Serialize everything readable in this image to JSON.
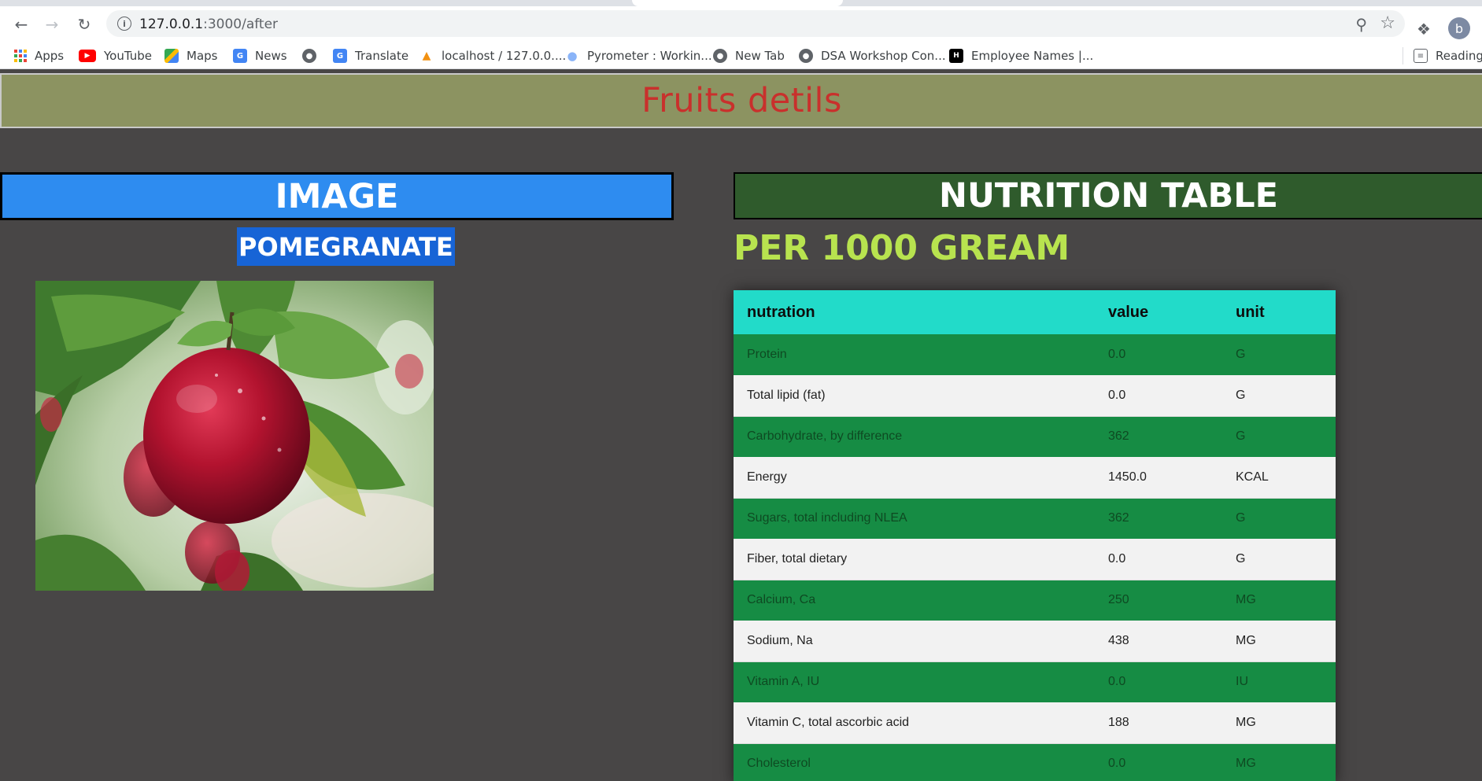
{
  "browser": {
    "url_host": "127.0.0.1",
    "url_path": ":3000/after",
    "profile_initial": "b",
    "bookmarks": [
      {
        "label": "Apps",
        "icon": "apps-grid-icon"
      },
      {
        "label": "YouTube",
        "icon": "youtube-icon"
      },
      {
        "label": "Maps",
        "icon": "maps-icon"
      },
      {
        "label": "News",
        "icon": "news-icon"
      },
      {
        "label": "",
        "icon": "globe-icon"
      },
      {
        "label": "Translate",
        "icon": "translate-icon"
      },
      {
        "label": "localhost / 127.0.0....",
        "icon": "phpmyadmin-icon"
      },
      {
        "label": "Pyrometer : Workin...",
        "icon": "bulb-icon"
      },
      {
        "label": "New Tab",
        "icon": "globe-icon"
      },
      {
        "label": "DSA Workshop Con...",
        "icon": "globe-icon"
      },
      {
        "label": "Employee Names |...",
        "icon": "hackerrank-icon"
      },
      {
        "label": "Reading",
        "icon": "reading-list-icon"
      }
    ]
  },
  "page": {
    "title": "Fruits detils",
    "image_header": "IMAGE",
    "fruit_name": "POMEGRANATE",
    "nutrition_header": "NUTRITION TABLE",
    "per_label": "PER 1000 GREAM"
  },
  "table": {
    "headers": [
      "nutration",
      "value",
      "unit"
    ],
    "rows": [
      [
        "Protein",
        "0.0",
        "G"
      ],
      [
        "Total lipid (fat)",
        "0.0",
        "G"
      ],
      [
        "Carbohydrate, by difference",
        "362",
        "G"
      ],
      [
        "Energy",
        "1450.0",
        "KCAL"
      ],
      [
        "Sugars, total including NLEA",
        "362",
        "G"
      ],
      [
        "Fiber, total dietary",
        "0.0",
        "G"
      ],
      [
        "Calcium, Ca",
        "250",
        "MG"
      ],
      [
        "Sodium, Na",
        "438",
        "MG"
      ],
      [
        "Vitamin A, IU",
        "0.0",
        "IU"
      ],
      [
        "Vitamin C, total ascorbic acid",
        "188",
        "MG"
      ],
      [
        "Cholesterol",
        "0.0",
        "MG"
      ]
    ]
  },
  "colors": {
    "page_bg": "#484646",
    "title_bar": "#8c9361",
    "title_text": "#c9302c",
    "image_header": "#2e8cf0",
    "nutrition_header": "#2f5b2c",
    "per_label": "#b8e34f",
    "table_header": "#22dbc9",
    "row_green": "#168c44",
    "row_light": "#f2f2f2"
  }
}
